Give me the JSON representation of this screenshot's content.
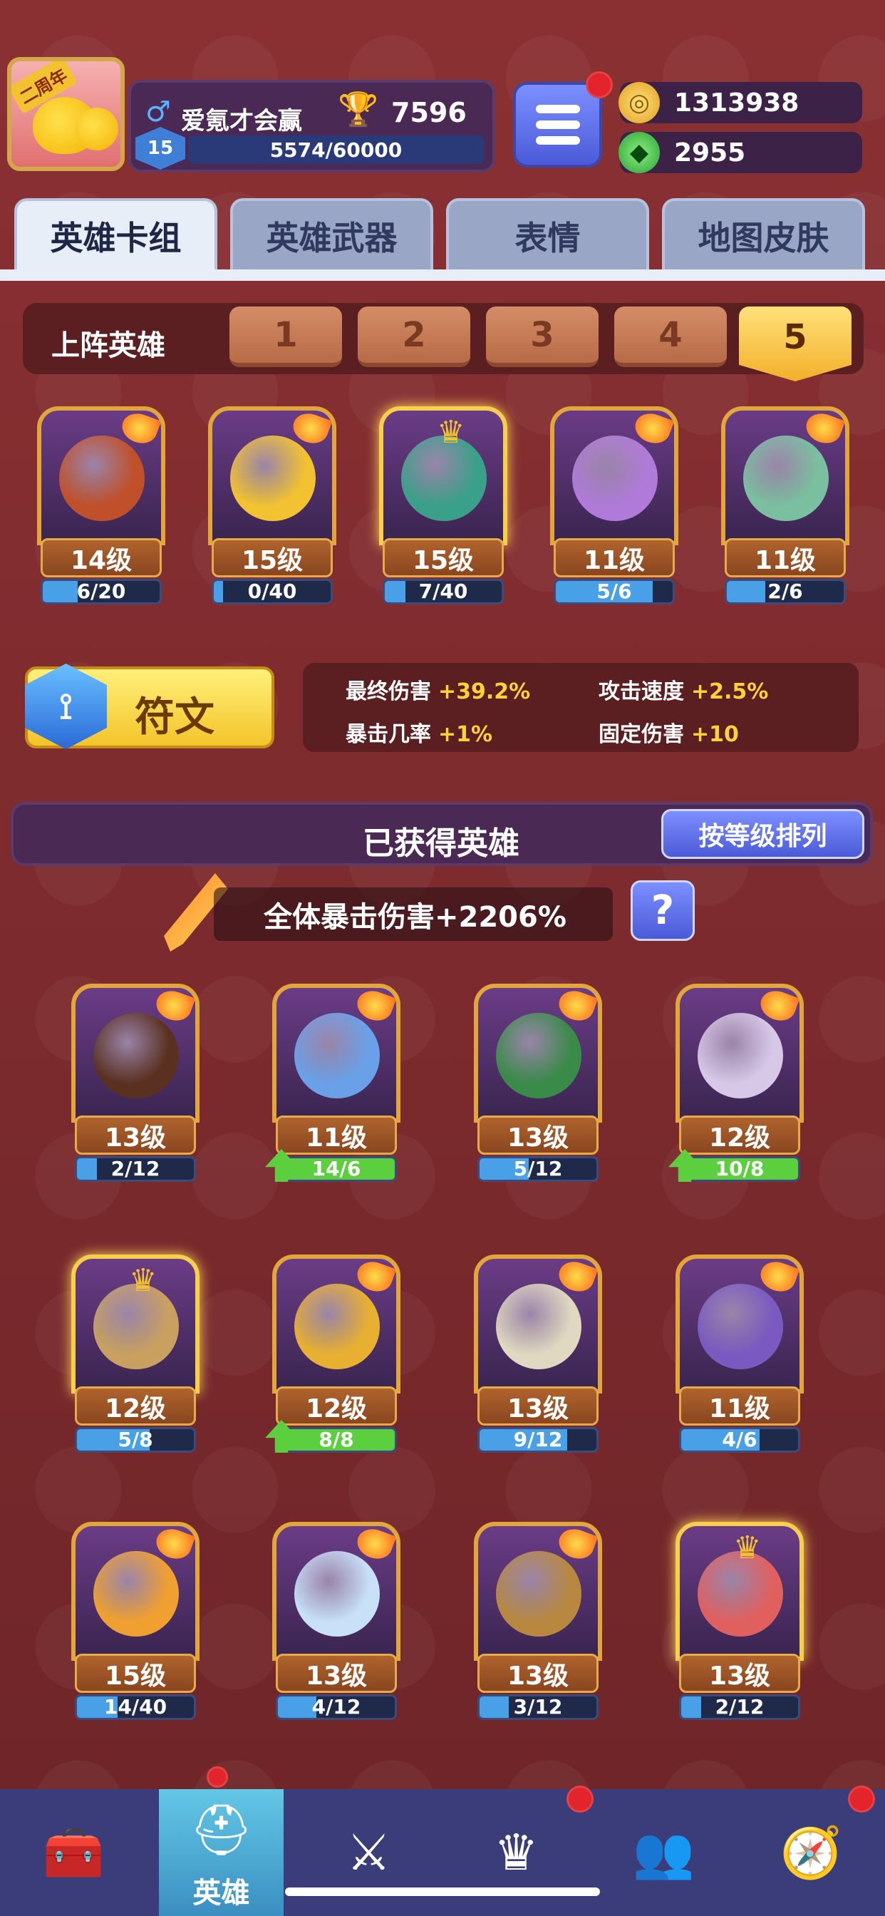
{
  "header": {
    "anniversary": "二周年",
    "player_name": "爱氪才会赢",
    "gender_icon": "♂",
    "trophies": "7596",
    "level": "15",
    "xp": "5574/60000",
    "gold": "1313938",
    "gems": "2955"
  },
  "tabs": [
    "英雄卡组",
    "英雄武器",
    "表情",
    "地图皮肤"
  ],
  "lineup": {
    "label": "上阵英雄",
    "decks": [
      "1",
      "2",
      "3",
      "4",
      "5"
    ],
    "active_deck": "5",
    "heroes": [
      {
        "level": "14级",
        "progress": "6/20",
        "fill": 0.3,
        "color": "#c0502a"
      },
      {
        "level": "15级",
        "progress": "0/40",
        "fill": 0.0,
        "color": "#f2c230"
      },
      {
        "level": "15级",
        "progress": "7/40",
        "fill": 0.175,
        "color": "#3aa08a"
      },
      {
        "level": "11级",
        "progress": "5/6",
        "fill": 0.83,
        "color": "#b07ad8"
      },
      {
        "level": "11级",
        "progress": "2/6",
        "fill": 0.33,
        "color": "#7ac0a0"
      }
    ]
  },
  "runes": {
    "label": "符文",
    "stats": [
      {
        "name": "最终伤害",
        "value": "+39.2%"
      },
      {
        "name": "攻击速度",
        "value": "+2.5%"
      },
      {
        "name": "暴击几率",
        "value": "+1%"
      },
      {
        "name": "固定伤害",
        "value": "+10"
      }
    ]
  },
  "owned": {
    "title": "已获得英雄",
    "sort_label": "按等级排列",
    "crit_banner": "全体暴击伤害+2206%",
    "help": "?",
    "heroes": [
      {
        "level": "13级",
        "progress": "2/12",
        "fill": 0.17,
        "upgrade": false,
        "color": "#5a3020"
      },
      {
        "level": "11级",
        "progress": "14/6",
        "fill": 1.0,
        "upgrade": true,
        "color": "#6aa0e8"
      },
      {
        "level": "13级",
        "progress": "5/12",
        "fill": 0.42,
        "upgrade": false,
        "color": "#3a8a4a"
      },
      {
        "level": "12级",
        "progress": "10/8",
        "fill": 1.0,
        "upgrade": true,
        "color": "#d8c8e8"
      },
      {
        "level": "12级",
        "progress": "5/8",
        "fill": 0.62,
        "upgrade": false,
        "color": "#c9a060"
      },
      {
        "level": "12级",
        "progress": "8/8",
        "fill": 1.0,
        "upgrade": true,
        "color": "#e8b030"
      },
      {
        "level": "13级",
        "progress": "9/12",
        "fill": 0.75,
        "upgrade": false,
        "color": "#e0d8c0"
      },
      {
        "level": "11级",
        "progress": "4/6",
        "fill": 0.67,
        "upgrade": false,
        "color": "#7a5ac0"
      },
      {
        "level": "15级",
        "progress": "14/40",
        "fill": 0.35,
        "upgrade": false,
        "color": "#f0a030"
      },
      {
        "level": "13级",
        "progress": "4/12",
        "fill": 0.33,
        "upgrade": false,
        "color": "#c8e0f8"
      },
      {
        "level": "13级",
        "progress": "3/12",
        "fill": 0.25,
        "upgrade": false,
        "color": "#b88840"
      },
      {
        "level": "13级",
        "progress": "2/12",
        "fill": 0.17,
        "upgrade": false,
        "color": "#e06060"
      }
    ]
  },
  "bottom_nav": [
    {
      "icon": "treasure-chest-icon",
      "glyph": "🧰",
      "label": ""
    },
    {
      "icon": "knight-helmet-icon",
      "glyph": "⛑",
      "label": "英雄"
    },
    {
      "icon": "crossed-swords-icon",
      "glyph": "⚔",
      "label": ""
    },
    {
      "icon": "crown-shield-icon",
      "glyph": "♛",
      "label": ""
    },
    {
      "icon": "friends-banner-icon",
      "glyph": "👥",
      "label": ""
    },
    {
      "icon": "compass-icon",
      "glyph": "🧭",
      "label": ""
    }
  ]
}
